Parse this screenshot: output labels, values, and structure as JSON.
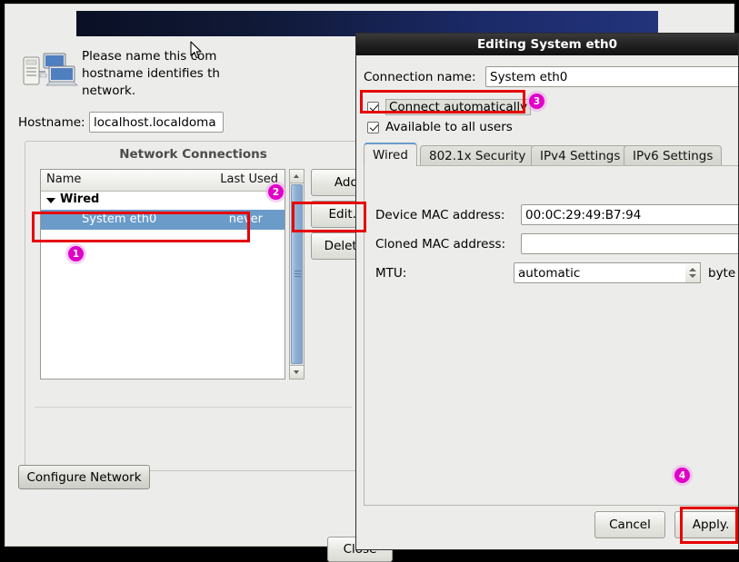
{
  "installer": {
    "intro_text": "Please name this com\nhostname identifies th\nnetwork.",
    "hostname_label": "Hostname:",
    "hostname_value": "localhost.localdoma",
    "configure_network_label": "Configure Network"
  },
  "network_connections": {
    "title": "Network Connections",
    "columns": [
      "Name",
      "Last Used"
    ],
    "groups": [
      {
        "label": "Wired",
        "expanded": true,
        "rows": [
          {
            "name": "System eth0",
            "last_used": "never",
            "selected": true
          }
        ]
      }
    ],
    "buttons": {
      "add": "Add",
      "edit": "Edit...",
      "delete": "Delete.",
      "close": "Close"
    }
  },
  "dialog": {
    "title": "Editing System eth0",
    "connection_name_label": "Connection name:",
    "connection_name_value": "System eth0",
    "checkboxes": [
      {
        "label": "Connect automatically",
        "checked": true
      },
      {
        "label": "Available to all users",
        "checked": true
      }
    ],
    "tabs": [
      {
        "label": "Wired",
        "active": true
      },
      {
        "label": "802.1x Security",
        "active": false
      },
      {
        "label": "IPv4 Settings",
        "active": false
      },
      {
        "label": "IPv6 Settings",
        "active": false
      }
    ],
    "wired_fields": {
      "device_mac_label": "Device MAC address:",
      "device_mac_value": "00:0C:29:49:B7:94",
      "cloned_mac_label": "Cloned MAC address:",
      "cloned_mac_value": "",
      "mtu_label": "MTU:",
      "mtu_value": "automatic",
      "mtu_unit": "byte"
    },
    "buttons": {
      "cancel": "Cancel",
      "apply": "Apply."
    }
  },
  "annotations": {
    "badges": [
      {
        "number": "1",
        "target": "connection-row"
      },
      {
        "number": "2",
        "target": "edit-button"
      },
      {
        "number": "3",
        "target": "connect-automatically-checkbox"
      },
      {
        "number": "4",
        "target": "apply-button"
      }
    ],
    "highlight_color": "#e60000",
    "badge_color": "#e000c8"
  }
}
